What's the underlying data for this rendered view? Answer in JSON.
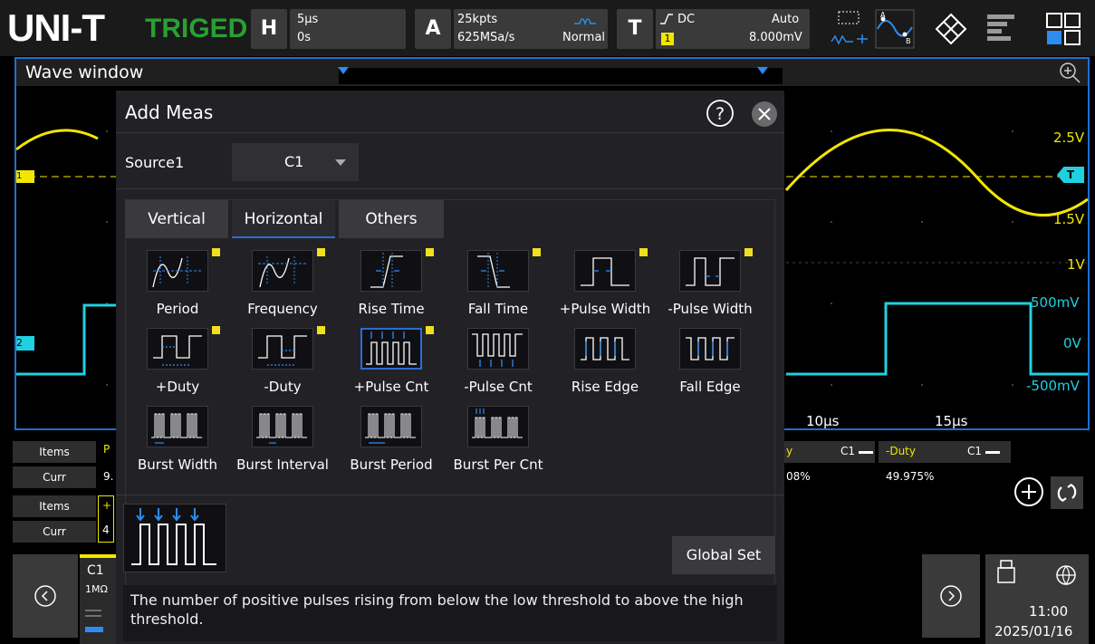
{
  "topbar": {
    "logo": "UNI-T",
    "status": "TRIGED",
    "horizontal": {
      "letter": "H",
      "timebase": "5μs",
      "offset": "0s"
    },
    "acquire": {
      "letter": "A",
      "depth": "25kpts",
      "rate": "625MSa/s",
      "mode": "Normal"
    },
    "trigger": {
      "letter": "T",
      "coupling": "DC",
      "mode": "Auto",
      "source": "1",
      "level": "8.000mV"
    }
  },
  "wave": {
    "title": "Wave window",
    "right_labels": [
      "2.5V",
      "1.5V",
      "1V",
      "500mV",
      "0V",
      "-500mV"
    ],
    "time_labels": [
      "10μs",
      "15μs"
    ],
    "ch1_marker": "1",
    "ch2_marker": "2",
    "trig_marker": "T"
  },
  "measure": {
    "row1": {
      "items": "Items",
      "curr": "Curr",
      "col_a": "P",
      "val_a": "9."
    },
    "row2": {
      "items": "Items",
      "curr": "Curr",
      "col_a": "+",
      "val_a": "4"
    },
    "duty_pos_label": "y",
    "duty_pos_src": "C1",
    "duty_pos_val": "08%",
    "duty_neg_label": "-Duty",
    "duty_neg_src": "C1",
    "duty_neg_val": "49.975%"
  },
  "dialog": {
    "title": "Add Meas",
    "source_label": "Source1",
    "source_value": "C1",
    "tabs": [
      "Vertical",
      "Horizontal",
      "Others"
    ],
    "items": [
      {
        "label": "Period",
        "badge": true
      },
      {
        "label": "Frequency",
        "badge": true
      },
      {
        "label": "Rise Time",
        "badge": true
      },
      {
        "label": "Fall Time",
        "badge": true
      },
      {
        "label": "+Pulse Width",
        "badge": true
      },
      {
        "label": "-Pulse Width",
        "badge": true
      },
      {
        "label": "+Duty",
        "badge": true
      },
      {
        "label": "-Duty",
        "badge": true
      },
      {
        "label": "+Pulse Cnt",
        "badge": true
      },
      {
        "label": "-Pulse Cnt",
        "badge": false
      },
      {
        "label": "Rise Edge",
        "badge": false
      },
      {
        "label": "Fall Edge",
        "badge": false
      },
      {
        "label": "Burst Width",
        "badge": false
      },
      {
        "label": "Burst Interval",
        "badge": false
      },
      {
        "label": "Burst Period",
        "badge": false
      },
      {
        "label": "Burst Per Cnt",
        "badge": false
      }
    ],
    "global_set": "Global Set",
    "description": "The number of positive pulses rising from below the low threshold to above the high threshold."
  },
  "bottom": {
    "channel": "C1",
    "impedance": "1MΩ",
    "time": "11:00",
    "date": "2025/01/16"
  },
  "colors": {
    "ch1": "#f2e600",
    "ch2": "#1fd1e0",
    "accent": "#1f6fd6",
    "badge": "#f0e020"
  }
}
